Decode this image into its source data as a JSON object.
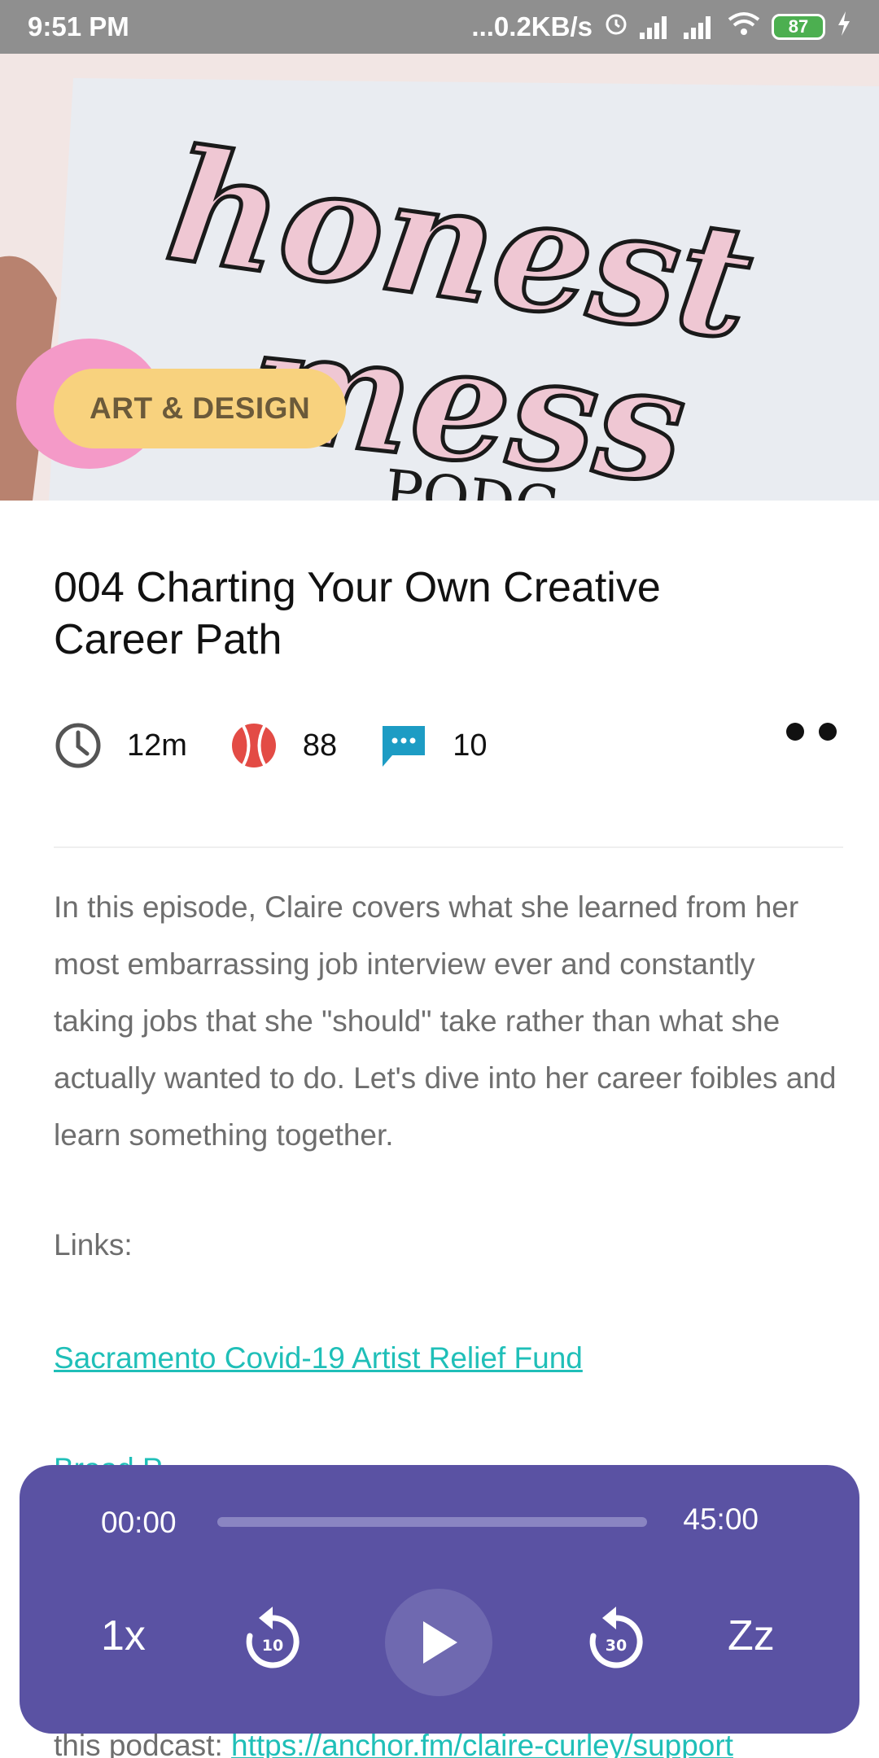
{
  "status_bar": {
    "time": "9:51 PM",
    "network_speed": "...0.2KB/s",
    "battery": "87",
    "icons": [
      "alarm-icon",
      "signal-icon",
      "signal-icon",
      "wifi-icon",
      "battery-icon",
      "charging-icon"
    ]
  },
  "hero": {
    "category": "ART & DESIGN",
    "artwork_text": "honest mess PODC",
    "colors": {
      "pill": "#f8d27e",
      "background": "#f1e4e2"
    }
  },
  "episode": {
    "title": "004 Charting Your Own Creative Career Path",
    "duration": "12m",
    "likes": "88",
    "comments": "10",
    "description": "In this episode, Claire covers what she learned from her most embarrassing job interview ever and constantly taking jobs that she \"should\" take rather than what she actually wanted to do. Let's dive into her career foibles and learn something together.",
    "links_label": "Links:",
    "link1": "Sacramento Covid-19 Artist Relief Fund",
    "link2_partial": "Bread P",
    "footer_prefix": "this podcast: ",
    "footer_link": "https://anchor.fm/claire-curley/support"
  },
  "player": {
    "current_time": "00:00",
    "total_time": "45:00",
    "progress": 0,
    "speed": "1x",
    "rewind_seconds": "10",
    "forward_seconds": "30",
    "sleep": "Zz",
    "colors": {
      "background": "#5a52a3",
      "accent": "#1fbfb8"
    }
  }
}
